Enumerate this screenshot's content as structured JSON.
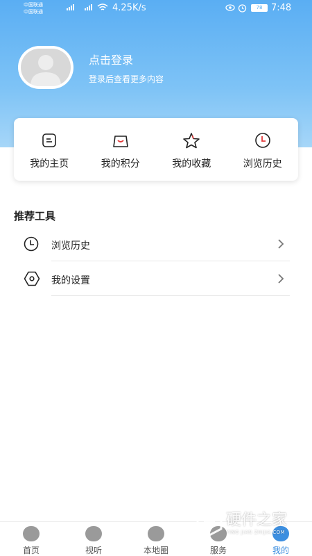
{
  "status_bar": {
    "carrier1": "中国联通",
    "carrier2": "中国联通",
    "network_speed": "4.25K/s",
    "battery": "78",
    "time": "7:48"
  },
  "profile": {
    "login_title": "点击登录",
    "login_subtitle": "登录后查看更多内容"
  },
  "quick_links": [
    {
      "label": "我的主页",
      "icon": "homepage-icon"
    },
    {
      "label": "我的积分",
      "icon": "shopping-bag-icon"
    },
    {
      "label": "我的收藏",
      "icon": "star-icon"
    },
    {
      "label": "浏览历史",
      "icon": "clock-icon"
    }
  ],
  "tools": {
    "title": "推荐工具",
    "items": [
      {
        "label": "浏览历史",
        "icon": "clock-icon"
      },
      {
        "label": "我的设置",
        "icon": "settings-hexagon-icon"
      }
    ]
  },
  "bottom_nav": [
    {
      "label": "首页",
      "icon": "home-icon",
      "active": false
    },
    {
      "label": "视听",
      "icon": "play-icon",
      "active": false
    },
    {
      "label": "本地圈",
      "icon": "local-circle-icon",
      "active": false
    },
    {
      "label": "服务",
      "icon": "service-icon",
      "active": false
    },
    {
      "label": "我的",
      "icon": "mine-icon",
      "active": true
    }
  ],
  "colors": {
    "accent": "#3d8fe0",
    "header_gradient_top": "#5aaef3",
    "header_gradient_bottom": "#a6d6f8"
  },
  "watermark": {
    "text": "硬件之家",
    "subtext": "YING JIAN ZHIJIA.COM"
  }
}
